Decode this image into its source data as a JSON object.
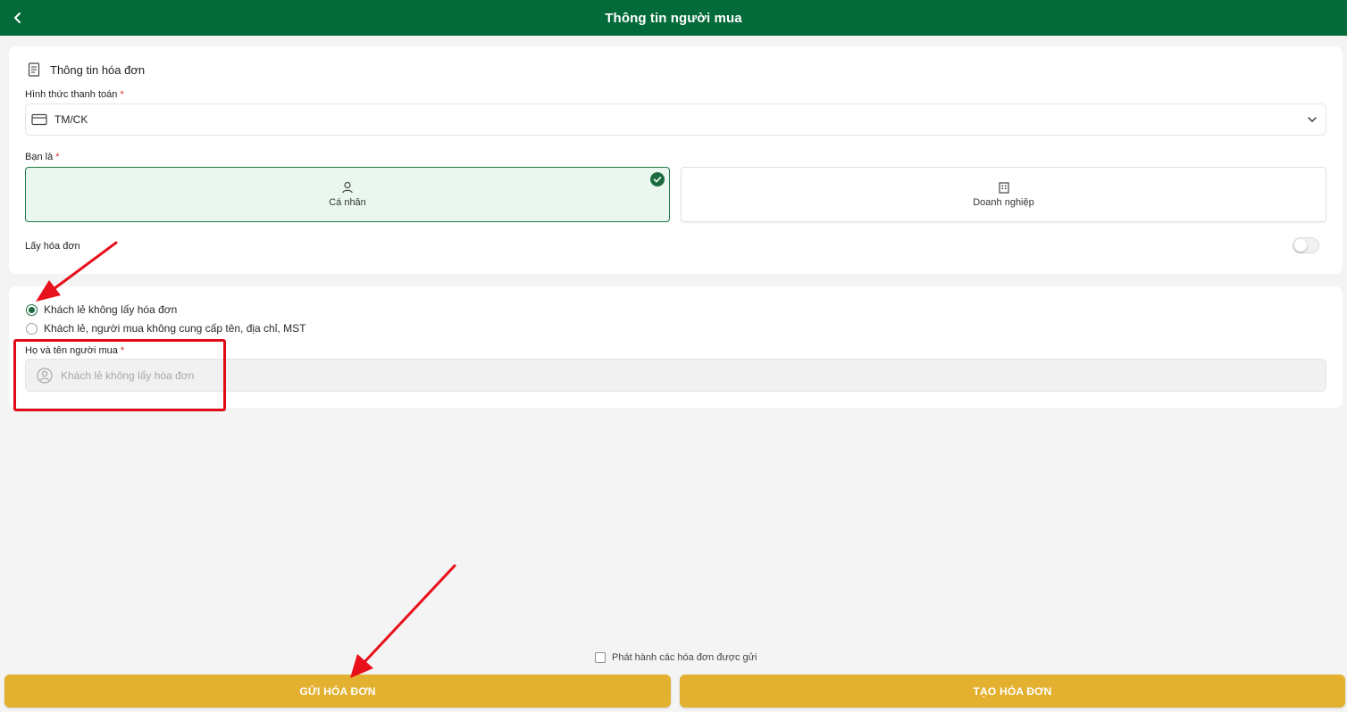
{
  "header": {
    "title": "Thông tin người mua",
    "back_icon": "chevron-left-icon"
  },
  "invoice_info": {
    "section_title": "Thông tin hóa đơn",
    "payment_label": "Hình thức thanh toán",
    "payment_value": "TM/CK",
    "you_are_label": "Bạn là",
    "options": [
      {
        "label": "Cá nhân",
        "icon": "user-icon",
        "selected": true
      },
      {
        "label": "Doanh nghiệp",
        "icon": "building-icon",
        "selected": false
      }
    ],
    "get_invoice_label": "Lấy hóa đơn",
    "get_invoice_on": false,
    "required_mark": "*"
  },
  "buyer": {
    "radios": [
      {
        "label": "Khách lẻ không lấy hóa đơn",
        "checked": true
      },
      {
        "label": "Khách lẻ, người mua không cung cấp tên, địa chỉ, MST",
        "checked": false
      }
    ],
    "name_label": "Họ và tên người mua",
    "name_placeholder": "Khách lẻ không lấy hóa đơn"
  },
  "footer": {
    "publish_label": "Phát hành các hóa đơn được gửi",
    "publish_checked": false,
    "send_button": "GỬI HÓA ĐƠN",
    "create_button": "TẠO HÓA ĐƠN"
  },
  "colors": {
    "header": "#036b3a",
    "accent_button": "#e3b12f",
    "selected_bg": "#e9f7ee",
    "annotation_red": "#e10b18"
  }
}
